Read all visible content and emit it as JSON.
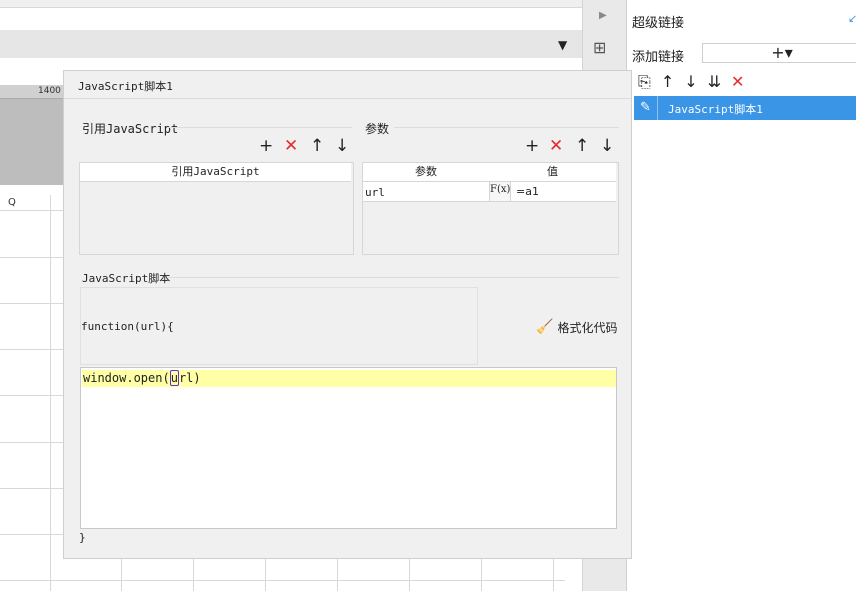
{
  "ruler": {
    "tick_label": "1400"
  },
  "grid": {
    "column_label": "Q"
  },
  "right_panel": {
    "title": "超级链接",
    "add_label": "添加链接",
    "add_button": "+▾",
    "tools": [
      "copy-icon",
      "arrow-up-icon",
      "arrow-down-icon",
      "sort-icon",
      "delete-icon"
    ],
    "items": [
      {
        "label": "JavaScript脚本1",
        "selected": true
      }
    ]
  },
  "dialog": {
    "title": "JavaScript脚本1",
    "ref_section": {
      "label": "引用JavaScript",
      "column": "引用JavaScript"
    },
    "param_section": {
      "label": "参数",
      "columns": [
        "参数",
        "值"
      ],
      "rows": [
        {
          "name": "url",
          "formula_icon": "F(x)",
          "value": "=a1"
        }
      ]
    },
    "script_section": {
      "label": "JavaScript脚本",
      "function_header": "function(url){",
      "format_button": "格式化代码",
      "code_pre": "window.open(",
      "code_cursor": "u",
      "code_post": "rl)",
      "closing": "}"
    }
  },
  "colors": {
    "accent": "#3a95e6",
    "delete": "#e52b2b",
    "highlight": "#ffffa6"
  }
}
